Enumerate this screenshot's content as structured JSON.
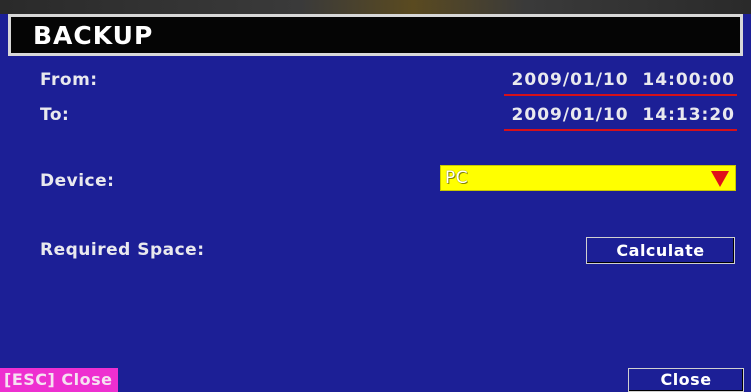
{
  "dialog": {
    "title": "BACKUP"
  },
  "from": {
    "label": "From:",
    "value": "2009/01/10  14:00:00"
  },
  "to": {
    "label": "To:",
    "value": "2009/01/10  14:13:20"
  },
  "device": {
    "label": "Device:",
    "selected": "PC",
    "accent_color": "#ffff00",
    "arrow_icon": "triangle-down-icon"
  },
  "required_space": {
    "label": "Required Space:",
    "calculate_label": "Calculate"
  },
  "footer": {
    "esc_label": "[ESC] Close",
    "close_label": "Close"
  },
  "colors": {
    "background": "#1c1f96",
    "esc_badge": "#ee2fd0",
    "underline": "#d6101a"
  }
}
